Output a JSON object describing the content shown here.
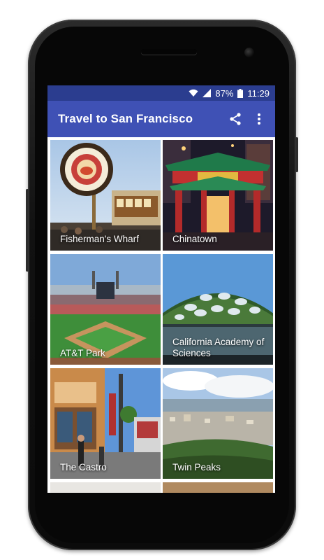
{
  "status_bar": {
    "battery": "87%",
    "time": "11:29"
  },
  "app_bar": {
    "title": "Travel to San Francisco"
  },
  "places": [
    {
      "label": "Fisherman's Wharf"
    },
    {
      "label": "Chinatown"
    },
    {
      "label": "AT&T Park"
    },
    {
      "label": "California Academy of Sciences"
    },
    {
      "label": "The Castro"
    },
    {
      "label": "Twin Peaks"
    }
  ],
  "colors": {
    "app_bar": "#3f51b5",
    "status_bar": "#2b3d8f"
  },
  "icons": {
    "share": "share-icon",
    "overflow": "more-vert-icon"
  }
}
